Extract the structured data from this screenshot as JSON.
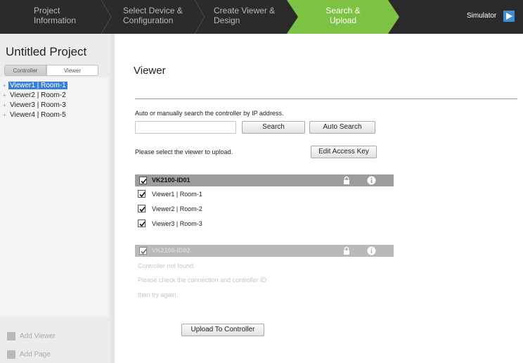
{
  "steps": [
    {
      "line1": "Project",
      "line2": "Information",
      "active": false
    },
    {
      "line1": "Select Device &",
      "line2": "Configuration",
      "active": false
    },
    {
      "line1": "Create Viewer &",
      "line2": "Design",
      "active": false
    },
    {
      "line1": "Search &",
      "line2": "Upload",
      "active": true
    }
  ],
  "simulator": {
    "label": "Simulator",
    "icon": "play-icon"
  },
  "colors": {
    "bar": "#2b2b2b",
    "active_step": "#7dc242",
    "sim_button": "#3d8fd6",
    "tree_selection": "#3a7fd6"
  },
  "sidebar": {
    "project_title": "Untitled Project",
    "tabs": [
      {
        "label": "Controller"
      },
      {
        "label": "Viewer"
      }
    ],
    "tree": [
      {
        "label": "Viewer1 | Room-1",
        "selected": true
      },
      {
        "label": "Viewer2 | Room-2",
        "selected": false
      },
      {
        "label": "Viewer3 | Room-3",
        "selected": false
      },
      {
        "label": "Viewer4 | Room-5",
        "selected": false
      }
    ],
    "add_viewer": "Add Viewer",
    "add_page": "Add Page"
  },
  "main": {
    "heading": "Viewer",
    "instruction": "Auto or manually search the controller by IP address.",
    "ip_value": "",
    "search_button": "Search",
    "auto_search_button": "Auto Search",
    "select_text": "Please select the viewer to upload.",
    "edit_key_button": "Edit Access Key",
    "controllers": [
      {
        "name": "VK2100-ID01",
        "checked": true,
        "disabled": false,
        "viewers": [
          {
            "label": "Viewer1 | Room-1",
            "checked": true
          },
          {
            "label": "Viewer2 | Room-2",
            "checked": true
          },
          {
            "label": "Viewer3 | Room-3",
            "checked": true
          }
        ]
      },
      {
        "name": "VK2100-ID02",
        "checked": true,
        "disabled": true,
        "messages": [
          "Controller not found.",
          "Please check the connection and controller ID",
          "then try again."
        ]
      }
    ],
    "upload_button": "Upload To Controller"
  }
}
